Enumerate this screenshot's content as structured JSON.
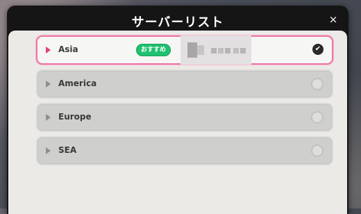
{
  "dialog": {
    "title": "サーバーリスト"
  },
  "servers": [
    {
      "name": "Asia",
      "badge": "おすすめ",
      "selected": true
    },
    {
      "name": "America",
      "selected": false
    },
    {
      "name": "Europe",
      "selected": false
    },
    {
      "name": "SEA",
      "selected": false
    }
  ],
  "icons": {
    "close": "×",
    "check": "✔"
  },
  "colors": {
    "accent": "#ec77a6",
    "badge": "#1fc16f"
  }
}
